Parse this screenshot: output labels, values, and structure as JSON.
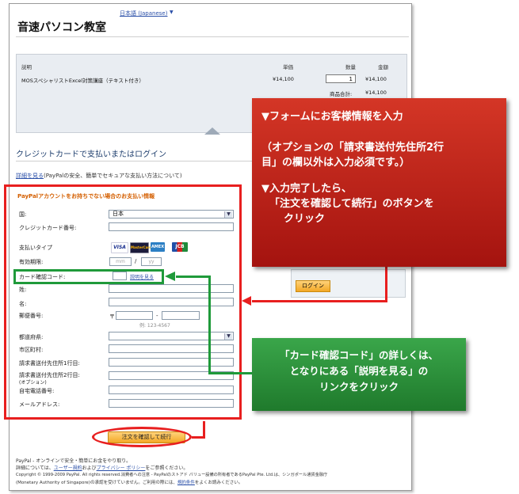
{
  "header": {
    "language": "日本語 (Japanese)",
    "shop_name": "音速パソコン教室"
  },
  "cart": {
    "col_description": "説明",
    "col_unit_price": "単価",
    "col_quantity": "数量",
    "col_amount": "金額",
    "item_name": "MOSスペシャリストExcel対策講座（テキスト付き）",
    "item_unit_price": "¥14,100",
    "item_quantity": "1",
    "item_amount": "¥14,100",
    "subtotal_label": "商品合計:",
    "subtotal_value": "¥14,100"
  },
  "payment": {
    "section_title": "クレジットカードで支払いまたはログイン",
    "details_link": "詳細を見る",
    "details_text": "(PayPalの安全、簡単でセキュアな支払い方法について)",
    "form_heading": "PayPalアカウントをお持ちでない場合のお支払い情報",
    "country_label": "国:",
    "country_value": "日本",
    "card_number_label": "クレジットカード番号:",
    "payment_type_label": "支払いタイプ",
    "card_brands": [
      "VISA",
      "MasterCard",
      "AMEX",
      "JCB"
    ],
    "expiry_label": "有効期限:",
    "expiry_month_placeholder": "mm",
    "expiry_year_placeholder": "yy",
    "expiry_separator": "/",
    "cvv_label": "カード確認コード:",
    "cvv_link": "説明を見る",
    "last_name_label": "姓:",
    "first_name_label": "名:",
    "postal_label": "郵便番号:",
    "postal_prefix": "〒",
    "postal_separator": "-",
    "postal_example": "例: 123-4567",
    "prefecture_label": "都道府県:",
    "city_label": "市区町村:",
    "address1_label": "請求書送付先住所1行目:",
    "address2_label": "請求書送付先住所2行目:",
    "address2_note": "(オプション)",
    "phone_label": "自宅電話番号:",
    "email_label": "メールアドレス:",
    "submit_button": "注文を確認して続行",
    "login_button": "ログイン"
  },
  "footer": {
    "line1": "PayPal - オンラインで安全・簡単にお金をやり取り。",
    "line2_pre": "詳細については、",
    "line2_link1": "ユーザー規約",
    "line2_mid": "および",
    "line2_link2": "プライバシー ポリシー",
    "line2_post": "をご参照ください。",
    "line3": "Copyright © 1999-2009 PayPal. All rights reserved.消費者への注意 - PayPalのストアド バリュー設備の所有者であるPayPal Pte. Ltd.は、シンガポール通貨金融庁",
    "line4_pre": "(Monetary Authority of Singapore)の承認を受けていません。ご利用の際には、",
    "line4_link": "規約条件",
    "line4_post": "をよくお読みください。"
  },
  "callouts": {
    "red_line1": "▼フォームにお客様情報を入力",
    "red_line2": "（オプションの「請求書送付先住所2行",
    "red_line3": "目」の欄以外は入力必須です。）",
    "red_line4": "▼入力完了したら、",
    "red_line5": "「注文を確認して続行」のボタンを",
    "red_line6": "クリック",
    "green_line1": "「カード確認コード」の詳しくは、",
    "green_line2": "となりにある「説明を見る」の",
    "green_line3": "リンクをクリック"
  },
  "colors": {
    "callout_red": "#b8231a",
    "callout_green": "#2e8f3e",
    "highlight_red": "#e81f1f",
    "highlight_green": "#1f9a3a",
    "form_heading": "#d45f00",
    "link": "#2a4fa8"
  }
}
